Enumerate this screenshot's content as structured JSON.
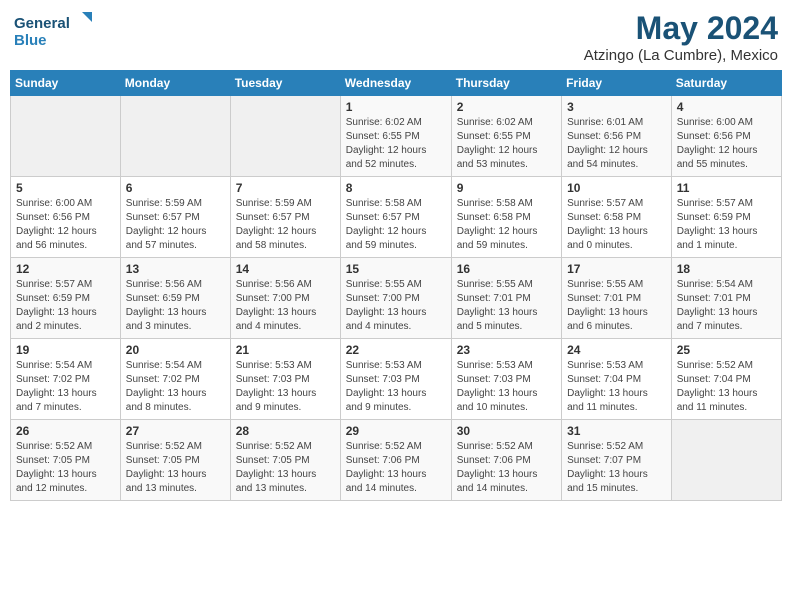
{
  "logo": {
    "line1": "General",
    "line2": "Blue"
  },
  "title": "May 2024",
  "subtitle": "Atzingo (La Cumbre), Mexico",
  "days_header": [
    "Sunday",
    "Monday",
    "Tuesday",
    "Wednesday",
    "Thursday",
    "Friday",
    "Saturday"
  ],
  "weeks": [
    [
      {
        "day": "",
        "info": ""
      },
      {
        "day": "",
        "info": ""
      },
      {
        "day": "",
        "info": ""
      },
      {
        "day": "1",
        "info": "Sunrise: 6:02 AM\nSunset: 6:55 PM\nDaylight: 12 hours\nand 52 minutes."
      },
      {
        "day": "2",
        "info": "Sunrise: 6:02 AM\nSunset: 6:55 PM\nDaylight: 12 hours\nand 53 minutes."
      },
      {
        "day": "3",
        "info": "Sunrise: 6:01 AM\nSunset: 6:56 PM\nDaylight: 12 hours\nand 54 minutes."
      },
      {
        "day": "4",
        "info": "Sunrise: 6:00 AM\nSunset: 6:56 PM\nDaylight: 12 hours\nand 55 minutes."
      }
    ],
    [
      {
        "day": "5",
        "info": "Sunrise: 6:00 AM\nSunset: 6:56 PM\nDaylight: 12 hours\nand 56 minutes."
      },
      {
        "day": "6",
        "info": "Sunrise: 5:59 AM\nSunset: 6:57 PM\nDaylight: 12 hours\nand 57 minutes."
      },
      {
        "day": "7",
        "info": "Sunrise: 5:59 AM\nSunset: 6:57 PM\nDaylight: 12 hours\nand 58 minutes."
      },
      {
        "day": "8",
        "info": "Sunrise: 5:58 AM\nSunset: 6:57 PM\nDaylight: 12 hours\nand 59 minutes."
      },
      {
        "day": "9",
        "info": "Sunrise: 5:58 AM\nSunset: 6:58 PM\nDaylight: 12 hours\nand 59 minutes."
      },
      {
        "day": "10",
        "info": "Sunrise: 5:57 AM\nSunset: 6:58 PM\nDaylight: 13 hours\nand 0 minutes."
      },
      {
        "day": "11",
        "info": "Sunrise: 5:57 AM\nSunset: 6:59 PM\nDaylight: 13 hours\nand 1 minute."
      }
    ],
    [
      {
        "day": "12",
        "info": "Sunrise: 5:57 AM\nSunset: 6:59 PM\nDaylight: 13 hours\nand 2 minutes."
      },
      {
        "day": "13",
        "info": "Sunrise: 5:56 AM\nSunset: 6:59 PM\nDaylight: 13 hours\nand 3 minutes."
      },
      {
        "day": "14",
        "info": "Sunrise: 5:56 AM\nSunset: 7:00 PM\nDaylight: 13 hours\nand 4 minutes."
      },
      {
        "day": "15",
        "info": "Sunrise: 5:55 AM\nSunset: 7:00 PM\nDaylight: 13 hours\nand 4 minutes."
      },
      {
        "day": "16",
        "info": "Sunrise: 5:55 AM\nSunset: 7:01 PM\nDaylight: 13 hours\nand 5 minutes."
      },
      {
        "day": "17",
        "info": "Sunrise: 5:55 AM\nSunset: 7:01 PM\nDaylight: 13 hours\nand 6 minutes."
      },
      {
        "day": "18",
        "info": "Sunrise: 5:54 AM\nSunset: 7:01 PM\nDaylight: 13 hours\nand 7 minutes."
      }
    ],
    [
      {
        "day": "19",
        "info": "Sunrise: 5:54 AM\nSunset: 7:02 PM\nDaylight: 13 hours\nand 7 minutes."
      },
      {
        "day": "20",
        "info": "Sunrise: 5:54 AM\nSunset: 7:02 PM\nDaylight: 13 hours\nand 8 minutes."
      },
      {
        "day": "21",
        "info": "Sunrise: 5:53 AM\nSunset: 7:03 PM\nDaylight: 13 hours\nand 9 minutes."
      },
      {
        "day": "22",
        "info": "Sunrise: 5:53 AM\nSunset: 7:03 PM\nDaylight: 13 hours\nand 9 minutes."
      },
      {
        "day": "23",
        "info": "Sunrise: 5:53 AM\nSunset: 7:03 PM\nDaylight: 13 hours\nand 10 minutes."
      },
      {
        "day": "24",
        "info": "Sunrise: 5:53 AM\nSunset: 7:04 PM\nDaylight: 13 hours\nand 11 minutes."
      },
      {
        "day": "25",
        "info": "Sunrise: 5:52 AM\nSunset: 7:04 PM\nDaylight: 13 hours\nand 11 minutes."
      }
    ],
    [
      {
        "day": "26",
        "info": "Sunrise: 5:52 AM\nSunset: 7:05 PM\nDaylight: 13 hours\nand 12 minutes."
      },
      {
        "day": "27",
        "info": "Sunrise: 5:52 AM\nSunset: 7:05 PM\nDaylight: 13 hours\nand 13 minutes."
      },
      {
        "day": "28",
        "info": "Sunrise: 5:52 AM\nSunset: 7:05 PM\nDaylight: 13 hours\nand 13 minutes."
      },
      {
        "day": "29",
        "info": "Sunrise: 5:52 AM\nSunset: 7:06 PM\nDaylight: 13 hours\nand 14 minutes."
      },
      {
        "day": "30",
        "info": "Sunrise: 5:52 AM\nSunset: 7:06 PM\nDaylight: 13 hours\nand 14 minutes."
      },
      {
        "day": "31",
        "info": "Sunrise: 5:52 AM\nSunset: 7:07 PM\nDaylight: 13 hours\nand 15 minutes."
      },
      {
        "day": "",
        "info": ""
      }
    ]
  ]
}
